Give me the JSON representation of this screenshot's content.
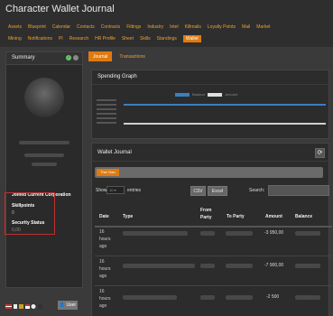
{
  "app": {
    "title": "Character Wallet Journal"
  },
  "nav": {
    "row1": [
      "Assets",
      "Blueprint",
      "Calendar",
      "Contacts",
      "Contracts",
      "Fittings",
      "Industry",
      "Intel",
      "Killmails",
      "Loyalty Points",
      "Mail",
      "Market"
    ],
    "row2": [
      "Mining",
      "Notifications",
      "PI",
      "Research",
      "HR Profile",
      "Sheet",
      "Skills",
      "Standings",
      "Wallet"
    ],
    "active": "Wallet"
  },
  "summary": {
    "title": "Summary",
    "joined_label": "Joined Current Corporation",
    "skillpoints_label": "Skillpoints",
    "skillpoints_value": "0",
    "security_label": "Security Status",
    "security_value": "0,00",
    "user_button": "User"
  },
  "tabs": [
    "Journal",
    "Transactions"
  ],
  "spending": {
    "title": "Spending Graph",
    "legend": [
      {
        "label": "Balance",
        "color": "#3a7fc0"
      },
      {
        "label": "Amount",
        "color": "#e0e0e0"
      }
    ],
    "balance_color": "#3a7fc0",
    "amount_color": "#d0d0d0"
  },
  "journal": {
    "title": "Wallet Journal",
    "filter_chip": "Ther Han",
    "show_label": "Show",
    "entries_value": "10",
    "entries_label": "entries",
    "csv": "CSV",
    "excel": "Excel",
    "search_label": "Search:",
    "search_value": "",
    "headers": [
      "Date",
      "Type",
      "From Party",
      "To Party",
      "Amount",
      "Balance"
    ],
    "rows": [
      {
        "date": "16 hours ago",
        "amount": "-3 950,00"
      },
      {
        "date": "16 hours ago",
        "amount": "-7 900,00"
      },
      {
        "date": "16 hours ago",
        "amount": "-2 500"
      }
    ]
  }
}
